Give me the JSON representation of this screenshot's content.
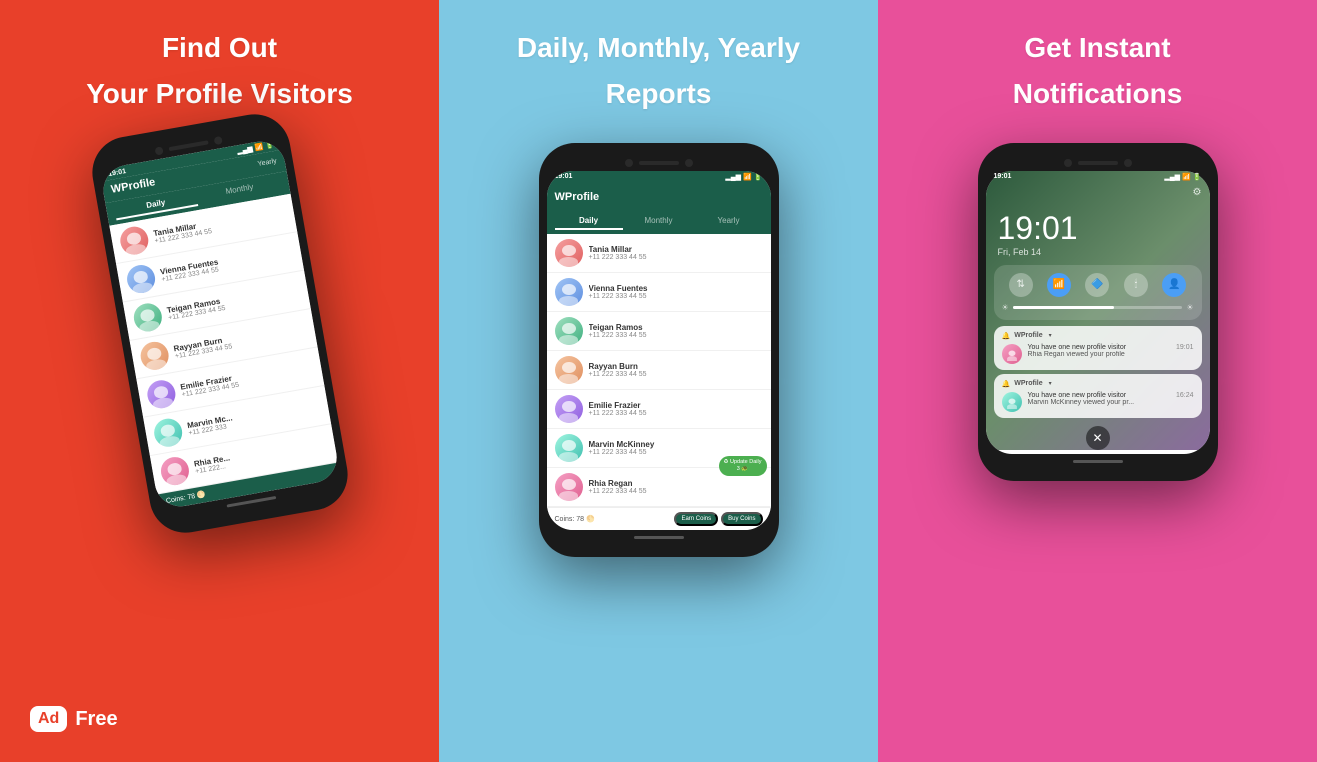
{
  "panels": {
    "left": {
      "title_line1": "Find Out",
      "title_line2": "Your Profile Visitors",
      "bg_color": "#E8402A"
    },
    "center": {
      "title_line1": "Daily, Monthly, Yearly",
      "title_line2": "Reports",
      "bg_color": "#7EC8E3"
    },
    "right": {
      "title_line1": "Get Instant",
      "title_line2": "Notifications",
      "bg_color": "#E8509A"
    }
  },
  "app": {
    "name": "WProfile",
    "status_time": "19:01",
    "tabs": {
      "daily": "Daily",
      "monthly": "Monthly",
      "yearly": "Yearly"
    },
    "coins_label": "Coins: 78",
    "earn_coins": "Earn Coins",
    "buy_coins": "Buy Coins",
    "update_btn": "Update Daily\n3 🐢"
  },
  "contacts": [
    {
      "name": "Tania Millar",
      "phone": "+11 222 333 44 55",
      "av_class": "av1"
    },
    {
      "name": "Vienna Fuentes",
      "phone": "+11 222 333 44 55",
      "av_class": "av2"
    },
    {
      "name": "Teigan Ramos",
      "phone": "+11 222 333 44 55",
      "av_class": "av3"
    },
    {
      "name": "Rayyan Burn",
      "phone": "+11 222 333 44 55",
      "av_class": "av4"
    },
    {
      "name": "Emilie Frazier",
      "phone": "+11 222 333 44 55",
      "av_class": "av5"
    },
    {
      "name": "Marvin McKinney",
      "phone": "+11 222 333 44 55",
      "av_class": "av6"
    },
    {
      "name": "Rhia Regan",
      "phone": "+11 222 333 44 55",
      "av_class": "av7"
    }
  ],
  "ad_badge": {
    "ad": "Ad",
    "free": "Free"
  },
  "lock_screen": {
    "time": "19:01",
    "date": "Fri, Feb 14",
    "notifications": [
      {
        "app": "WProfile",
        "time": "19:01",
        "title": "You have one new profile visitor",
        "desc": "Rhia Regan viewed your profile",
        "av_class": "av7"
      },
      {
        "app": "WProfile",
        "time": "16:24",
        "title": "You have one new profile visitor",
        "desc": "Marvin McKinney viewed your pr...",
        "av_class": "av6"
      }
    ]
  }
}
